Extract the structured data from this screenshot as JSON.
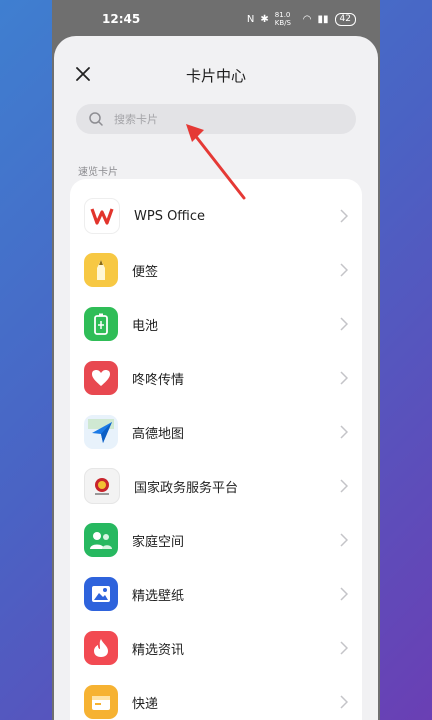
{
  "status_bar": {
    "time": "12:45",
    "net_speed": "81.0 KB/S",
    "battery": "42"
  },
  "header": {
    "title": "卡片中心"
  },
  "search": {
    "placeholder": "搜索卡片"
  },
  "section": {
    "label": "速览卡片"
  },
  "cards": [
    {
      "label": "WPS Office",
      "icon": "wps-office-icon",
      "color": "#ffffff"
    },
    {
      "label": "便签",
      "icon": "notes-icon",
      "color": "#f7c843"
    },
    {
      "label": "电池",
      "icon": "battery-icon",
      "color": "#2fbd57"
    },
    {
      "label": "咚咚传情",
      "icon": "heart-icon",
      "color": "#e84850"
    },
    {
      "label": "高德地图",
      "icon": "amap-icon",
      "color": "#e8f2fb"
    },
    {
      "label": "国家政务服务平台",
      "icon": "gov-service-icon",
      "color": "#f3f3f3"
    },
    {
      "label": "家庭空间",
      "icon": "family-space-icon",
      "color": "#27b860"
    },
    {
      "label": "精选壁纸",
      "icon": "wallpaper-icon",
      "color": "#2e63dc"
    },
    {
      "label": "精选资讯",
      "icon": "news-icon",
      "color": "#f24a52"
    },
    {
      "label": "快递",
      "icon": "express-icon",
      "color": "#f6b232"
    }
  ]
}
